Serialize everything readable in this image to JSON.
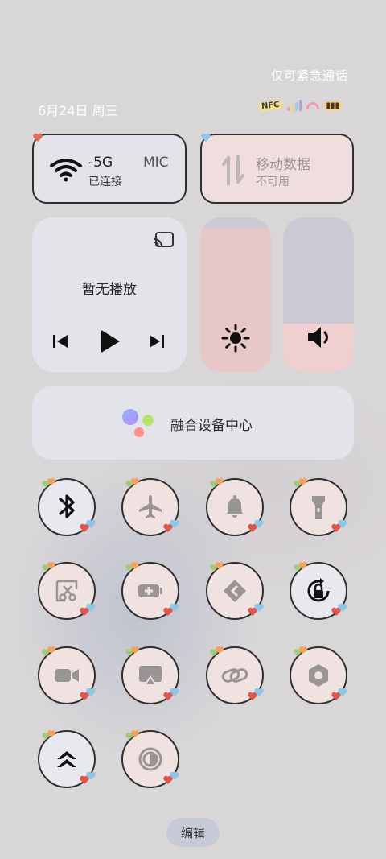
{
  "status": {
    "emergency_text": "仅可紧急通话",
    "date": "6月24日 周三",
    "nfc_label": "NFC"
  },
  "tiles": {
    "wifi": {
      "name": "-5G",
      "suffix": "MIC",
      "state": "已连接"
    },
    "mobile_data": {
      "name": "移动数据",
      "state": "不可用"
    }
  },
  "media": {
    "status": "暂无播放"
  },
  "sliders": {
    "brightness_level": 0.93,
    "volume_level": 0.31
  },
  "hub": {
    "label": "融合设备中心"
  },
  "toggles": [
    {
      "icon": "bluetooth-icon",
      "active": true
    },
    {
      "icon": "airplane-icon",
      "active": false
    },
    {
      "icon": "bell-icon",
      "active": false
    },
    {
      "icon": "flashlight-icon",
      "active": false
    },
    {
      "icon": "screenshot-icon",
      "active": false
    },
    {
      "icon": "battery-saver-icon",
      "active": false
    },
    {
      "icon": "share-icon",
      "active": false
    },
    {
      "icon": "rotation-lock-icon",
      "active": true
    },
    {
      "icon": "screen-record-icon",
      "active": false
    },
    {
      "icon": "screen-cast-icon",
      "active": false
    },
    {
      "icon": "link-icon",
      "active": false
    },
    {
      "icon": "settings-hex-icon",
      "active": false
    },
    {
      "icon": "performance-mode-icon",
      "active": true
    },
    {
      "icon": "dark-mode-icon",
      "active": false
    }
  ],
  "footer": {
    "edit_label": "编辑"
  },
  "colors": {
    "accent_pink": "#efcfd0",
    "tile_gray": "#e2e4ea",
    "outline": "#2f2f2f"
  }
}
